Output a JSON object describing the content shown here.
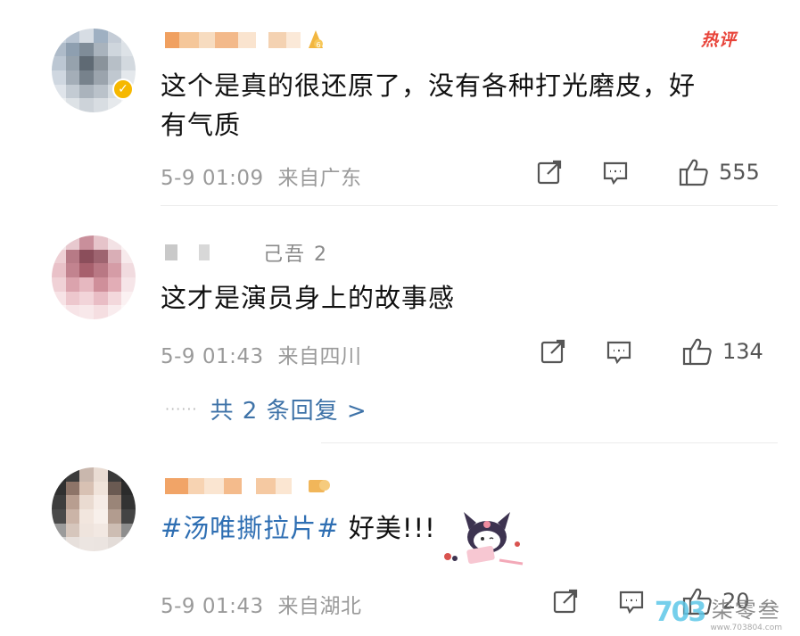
{
  "comments": [
    {
      "content": "这个是真的很还原了，没有各种打光磨皮，好有气质",
      "content_line1": "这个是真的很还原了，没有各种打光磨皮，好",
      "content_line2": "有气质",
      "badge": "热评",
      "time": "5-9 01:09",
      "location": "来自广东",
      "likes": "555",
      "verified": true
    },
    {
      "username_fragment": "己吾 2",
      "content": "这才是演员身上的故事感",
      "time": "5-9 01:43",
      "location": "来自四川",
      "likes": "134",
      "replies_dots": "······",
      "replies_label": "共 2 条回复 >"
    },
    {
      "hashtag": "#汤唯撕拉片#",
      "text": " 好美!!!",
      "time": "5-9 01:43",
      "location": "来自湖北",
      "likes": "20"
    }
  ],
  "watermark": {
    "logo": "703",
    "name": "柒零叁",
    "url": "www.703804.com"
  },
  "colors": {
    "hashtag": "#2f6fb3",
    "reply_link": "#3f73a8",
    "hot_badge": "#e8443a",
    "meta": "#9a9a9a"
  },
  "icons": [
    "repost-icon",
    "comment-icon",
    "like-icon",
    "verified-badge-icon",
    "level-badge-icon"
  ]
}
